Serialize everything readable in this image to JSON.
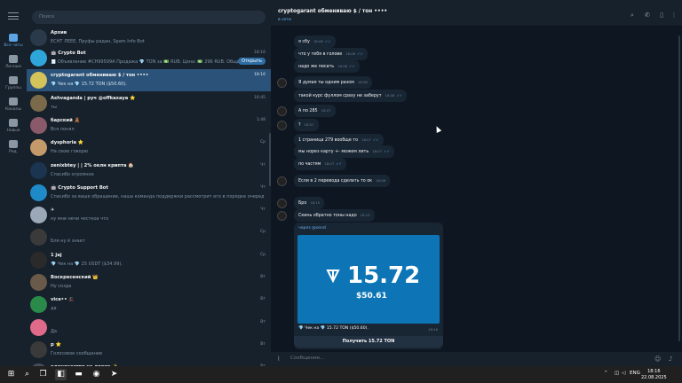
{
  "rail": {
    "items": [
      {
        "label": "Все чаты",
        "active": true
      },
      {
        "label": "Личные"
      },
      {
        "label": "Группы"
      },
      {
        "label": "Каналы"
      },
      {
        "label": "Новые"
      },
      {
        "label": "Ред."
      }
    ]
  },
  "search": {
    "placeholder": "Поиск"
  },
  "chats": [
    {
      "name": "Архив",
      "preview": "ECHT ЛЕЕЕ, Пруфы радан, Spam Info Bot",
      "time": "",
      "avatar_color": "#2b3a4a"
    },
    {
      "name": "🤖 Crypto Bot",
      "preview": "🧾 Объявление #CH99599А Продажа 💎 TON за 💵 RUB. Цена: 💵 296 RUB. Общий...",
      "time": "18:16",
      "button": "Открыть",
      "avatar_color": "#2ea6d9"
    },
    {
      "name": "cryptogarant обмениваю $ / тон ••••",
      "preview": "💎 Чек на 💎 15.72 TON ($50.60).",
      "time": "18:16",
      "avatar_color": "#d4c25a",
      "active": true
    },
    {
      "name": "Ashvaganda | руч @offkaxaya ⭐",
      "preview": "ты",
      "time": "16:45",
      "avatar_color": "#7a6a4a"
    },
    {
      "name": "барский 🧸",
      "preview": "Вся понял",
      "time": "1:48",
      "avatar_color": "#8a5a6a"
    },
    {
      "name": "dysphoria ⭐",
      "preview": "На свою говорю",
      "time": "Ср",
      "avatar_color": "#c49a6a"
    },
    {
      "name": "zenixbtey | | 2% оклн крипта 🏠",
      "preview": "Спасибо огромное",
      "time": "Чт",
      "avatar_color": "#1b3550"
    },
    {
      "name": "🤖 Crypto Support Bot",
      "preview": "Спасибо за ваше обращение, наша команда поддержки рассмотрит его в порядке очереди.",
      "time": "Чт",
      "avatar_color": "#1e8ac7"
    },
    {
      "name": "✈",
      "preview": "ну мне нечи честкоа что",
      "time": "Чт",
      "avatar_color": "#9aa8b8"
    },
    {
      "name": "",
      "preview": "Бля ну ë знает",
      "time": "Ср",
      "avatar_color": "#3a3a3a"
    },
    {
      "name": "1 jaj",
      "preview": "💎 Чек на 💎 25 USDT ($34.99).",
      "time": "Ср",
      "avatar_color": "#2a2a2a"
    },
    {
      "name": "Воскресенский 👑",
      "preview": "Ну созда",
      "time": "Вт",
      "avatar_color": "#6a5a4a"
    },
    {
      "name": "vice•• 🎩",
      "preview": "да",
      "time": "Вт",
      "avatar_color": "#2a8a4a"
    },
    {
      "name": "",
      "preview": "Да",
      "time": "Вт",
      "avatar_color": "#e06a8a"
    },
    {
      "name": "р ⭐",
      "preview": "Голосовое сообщение",
      "time": "Вт",
      "avatar_color": "#3a3a3a"
    },
    {
      "name": "одиночество на двоих ✨",
      "preview": "",
      "time": "Вт",
      "avatar_color": "#4a4a5a"
    }
  ],
  "header": {
    "title": "cryptogarant обмениваю $ / тон ••••",
    "status": "в сети"
  },
  "messages": [
    {
      "text": "я сбу",
      "time": "18:08"
    },
    {
      "text": "что у тебя в голове",
      "time": "18:08"
    },
    {
      "text": "надо же писать",
      "time": "18:08"
    },
    {
      "text": "Я думая ты одним разом",
      "time": "18:08",
      "incoming": true
    },
    {
      "text": "такой курс фуллом сразу не заберут",
      "time": "18:08"
    },
    {
      "text": "А по 285",
      "time": "18:07",
      "incoming": true
    },
    {
      "text": "?",
      "time": "18:07",
      "incoming": true
    },
    {
      "text": "1 страница 279 вообще то",
      "time": "18:07"
    },
    {
      "text": "мы норез карту +- можем лить",
      "time": "18:07"
    },
    {
      "text": "по частям",
      "time": "18:07"
    },
    {
      "text": "Если в 2 перевода сделать то ок",
      "time": "18:08",
      "incoming": true
    },
    {
      "text": "Бро",
      "time": "18:15",
      "incoming": true
    },
    {
      "text": "Скинь обратно тоны надо",
      "time": "18:15",
      "incoming": true
    }
  ],
  "card": {
    "header": "через @send",
    "amount": "15.72",
    "usd": "$50.61",
    "caption": "💎 Чек на 💎 15.72 TON ($50.60).",
    "time": "18:16",
    "button": "Получить 15.72 TON"
  },
  "composer": {
    "placeholder": "Сообщение..."
  },
  "taskbar": {
    "lang": "ENG",
    "time": "18:16",
    "date": "22.08.2025"
  },
  "colors": {
    "accent": "#2b5278",
    "bubble": "#182533",
    "link": "#6ab2f2",
    "ton_bg": "#0d75b6"
  }
}
